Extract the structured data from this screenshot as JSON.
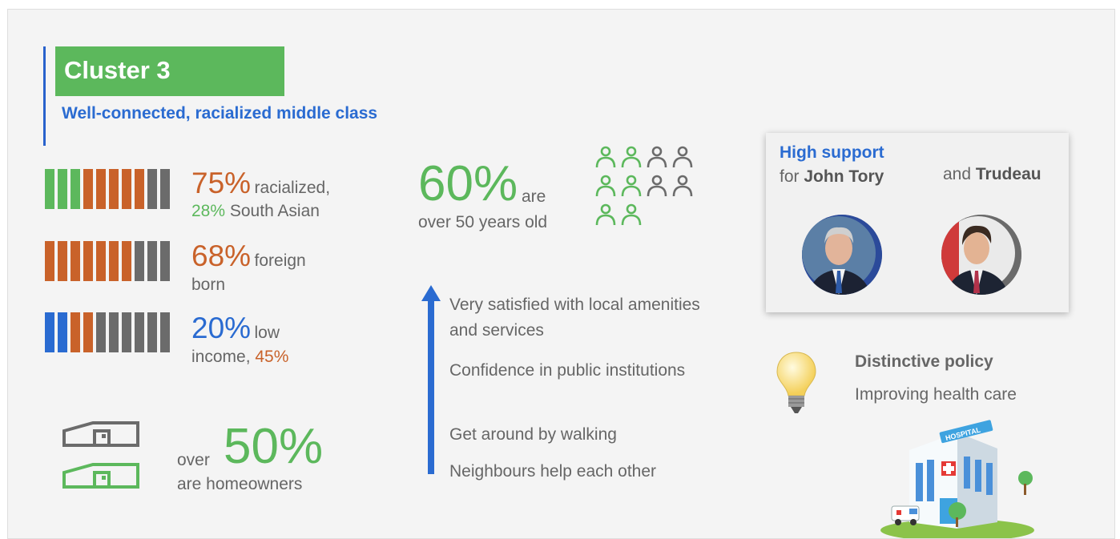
{
  "title": "Cluster 3",
  "subtitle": "Well-connected, racialized middle class",
  "colors": {
    "green": "#5cb85c",
    "orange": "#c9622a",
    "blue": "#2a6bd1",
    "gray": "#6b6b6b"
  },
  "stats": {
    "racialized": {
      "value": "75%",
      "label": "racialized,",
      "sub_value": "28%",
      "sub_label": "South Asian",
      "bars": [
        "green",
        "green",
        "green",
        "orange",
        "orange",
        "orange",
        "orange",
        "orange",
        "gray",
        "gray"
      ]
    },
    "foreign_born": {
      "value": "68%",
      "label": "foreign",
      "label2": "born",
      "bars": [
        "orange",
        "orange",
        "orange",
        "orange",
        "orange",
        "orange",
        "orange",
        "gray",
        "gray",
        "gray"
      ]
    },
    "low_income": {
      "value": "20%",
      "label": "low",
      "label2": "income,",
      "sub_value": "45%",
      "bars": [
        "blue",
        "blue",
        "orange",
        "orange",
        "gray",
        "gray",
        "gray",
        "gray",
        "gray",
        "gray"
      ]
    }
  },
  "homeowners": {
    "prefix": "over",
    "value": "50%",
    "label": "are homeowners"
  },
  "age": {
    "value": "60%",
    "are": "are",
    "label": "over 50 years old"
  },
  "satisfaction_items": [
    "Very satisfied with local amenities and services",
    "Confidence in public institutions",
    "Get around by walking",
    "Neighbours help each other"
  ],
  "support": {
    "head": "High support",
    "for_text": "for",
    "tory": "John Tory",
    "and_text": "and",
    "trudeau": "Trudeau"
  },
  "policy": {
    "head": "Distinctive policy",
    "text": "Improving health care"
  },
  "hospital_sign": "HOSPITAL",
  "icons": {
    "people": "people-icon",
    "house": "house-icon",
    "arrow": "arrow-up-icon",
    "bulb": "lightbulb-icon",
    "hospital": "hospital-icon"
  }
}
